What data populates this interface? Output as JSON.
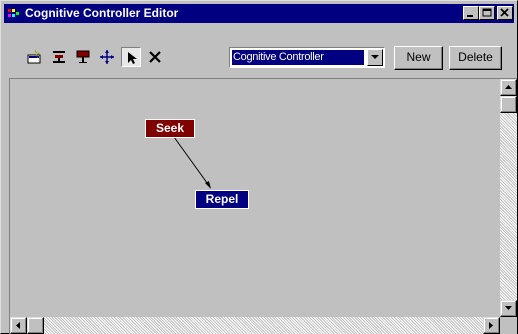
{
  "window": {
    "title": "Cognitive Controller Editor"
  },
  "toolbar": {
    "tools": [
      {
        "icon": "new-node-icon"
      },
      {
        "icon": "align-icon"
      },
      {
        "icon": "pin-icon"
      },
      {
        "icon": "move-icon"
      },
      {
        "icon": "pointer-icon",
        "active": true
      },
      {
        "icon": "delete-x-icon"
      }
    ],
    "controller_select": {
      "value": "Cognitive Controller"
    },
    "new_label": "New",
    "delete_label": "Delete"
  },
  "graph": {
    "nodes": [
      {
        "label": "Seek",
        "color": "#800000"
      },
      {
        "label": "Repel",
        "color": "#000080"
      }
    ],
    "edges": [
      {
        "from": "Seek",
        "to": "Repel"
      }
    ]
  },
  "colors": {
    "titlebar": "#000080",
    "window": "#c0c0c0"
  }
}
